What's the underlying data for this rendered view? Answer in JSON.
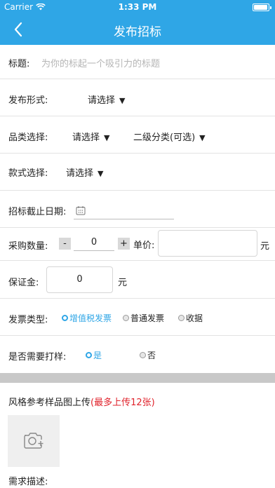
{
  "status_bar": {
    "carrier": "Carrier",
    "time": "1:33 PM"
  },
  "nav": {
    "title": "发布招标"
  },
  "form": {
    "title": {
      "label": "标题:",
      "placeholder": "为你的标起一个吸引力的标题"
    },
    "publish_form": {
      "label": "发布形式:",
      "value": "请选择"
    },
    "category": {
      "label": "品类选择:",
      "value": "请选择",
      "secondary": "二级分类(可选)"
    },
    "style": {
      "label": "款式选择:",
      "value": "请选择"
    },
    "deadline": {
      "label": "招标截止日期:"
    },
    "quantity": {
      "label": "采购数量:",
      "minus": "-",
      "value": "0",
      "plus": "+",
      "unit_price_label": "单价:",
      "currency": "元"
    },
    "deposit": {
      "label": "保证金:",
      "value": "0",
      "currency": "元"
    },
    "invoice": {
      "label": "发票类型:",
      "options": [
        "增值税发票",
        "普通发票",
        "收据"
      ],
      "selected": 0
    },
    "sample": {
      "label": "是否需要打样:",
      "options": [
        "是",
        "否"
      ],
      "selected": 0
    }
  },
  "upload": {
    "title": "风格参考样品图上传",
    "note": "(最多上传12张)"
  },
  "description": {
    "label": "需求描述:"
  },
  "colors": {
    "accent": "#2fa6e6",
    "warning": "#e0222b"
  }
}
